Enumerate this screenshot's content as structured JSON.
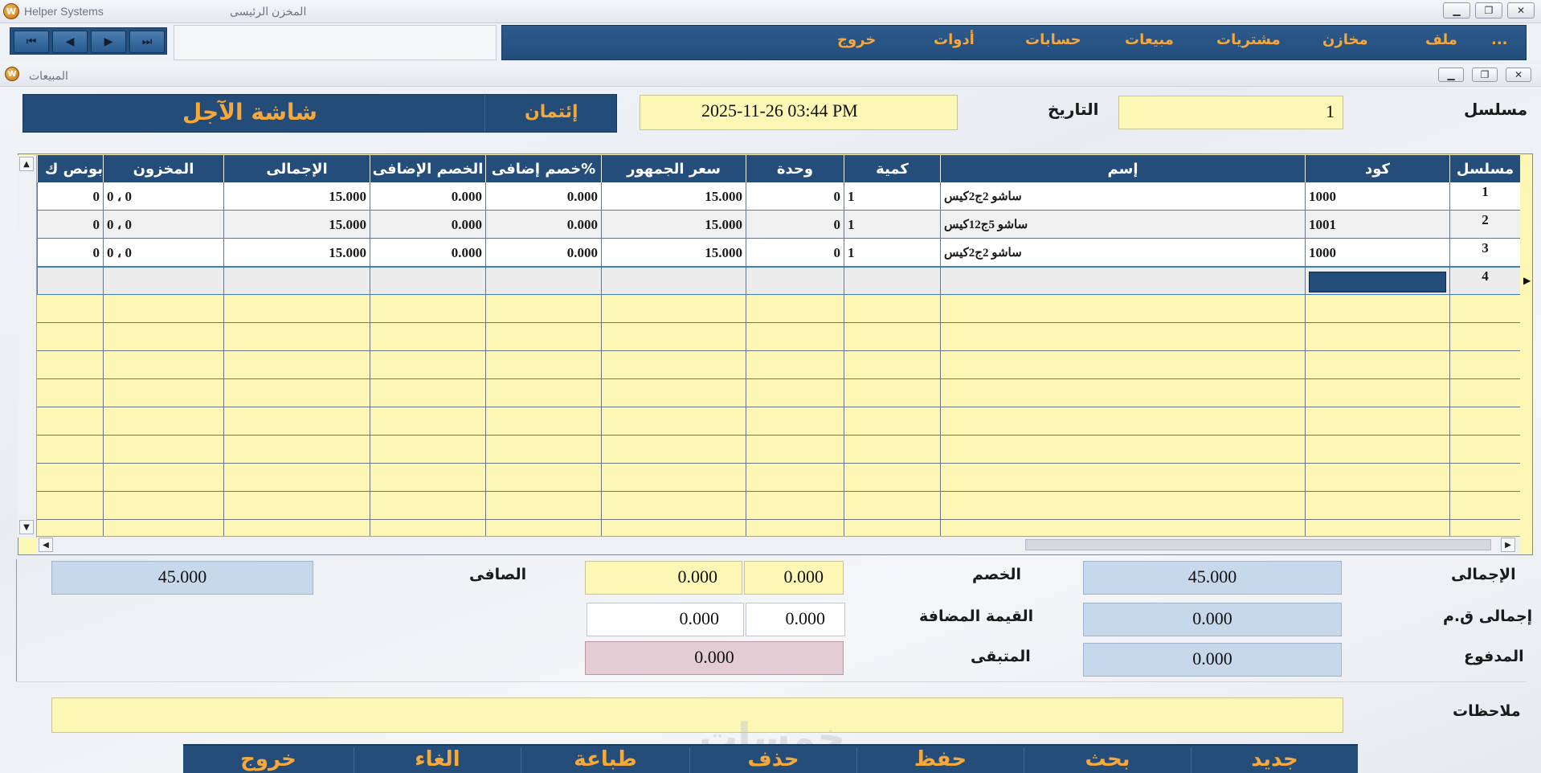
{
  "window": {
    "app_title": "Helper Systems",
    "store_title": "المخزن الرئيسى",
    "controls": [
      "minimize",
      "restore",
      "close"
    ]
  },
  "menu": {
    "items": [
      "...",
      "ملف",
      "مخازن",
      "مشتريات",
      "مبيعات",
      "حسابات",
      "أدوات",
      "خروج"
    ]
  },
  "nav": {
    "first": "⏮",
    "prev": "◀",
    "next": "▶",
    "last": "⏭"
  },
  "child_window": {
    "title": "المبيعات"
  },
  "header": {
    "serial_label": "مسلسل",
    "serial_value": "1",
    "date_label": "التاريخ",
    "date_value": "2025-11-26 03:44 PM",
    "payment_type": "إئتمان",
    "screen_title": "شاشة الآجل"
  },
  "grid": {
    "columns": [
      "مسلسل",
      "كود",
      "إسم",
      "كمية",
      "وحدة",
      "سعر الجمهور",
      "خصم إضافى%",
      "الخصم الإضافى",
      "الإجمالى",
      "المخزون",
      "بونص ك"
    ],
    "rows": [
      {
        "serial": "1",
        "code": "1000",
        "name": "ساشو 2ج2كيس",
        "qty": "1",
        "unit": "0",
        "price": "15.000",
        "disc_pct": "0.000",
        "disc": "0.000",
        "total": "15.000",
        "stock": "0 ، 0",
        "bonus": "0"
      },
      {
        "serial": "2",
        "code": "1001",
        "name": "ساشو 5ج12كيس",
        "qty": "1",
        "unit": "0",
        "price": "15.000",
        "disc_pct": "0.000",
        "disc": "0.000",
        "total": "15.000",
        "stock": "0 ، 0",
        "bonus": "0"
      },
      {
        "serial": "3",
        "code": "1000",
        "name": "ساشو 2ج2كيس",
        "qty": "1",
        "unit": "0",
        "price": "15.000",
        "disc_pct": "0.000",
        "disc": "0.000",
        "total": "15.000",
        "stock": "0 ، 0",
        "bonus": "0"
      },
      {
        "serial": "4",
        "code": "",
        "name": "",
        "qty": "",
        "unit": "",
        "price": "",
        "disc_pct": "",
        "disc": "",
        "total": "",
        "stock": "",
        "bonus": ""
      }
    ]
  },
  "totals": {
    "total_label": "الإجمالى",
    "total_value": "45.000",
    "vat_total_label": "إجمالى ق.م",
    "vat_total_value": "0.000",
    "paid_label": "المدفوع",
    "paid_value": "0.000",
    "discount_label": "الخصم",
    "discount_pct": "0.000",
    "discount_value": "0.000",
    "vat_label": "القيمة المضافة",
    "vat_pct": "0.000",
    "vat_value": "0.000",
    "remaining_label": "المتبقى",
    "remaining_value": "0.000",
    "net_label": "الصافى",
    "net_value": "45.000"
  },
  "notes": {
    "label": "ملاحظات",
    "value": ""
  },
  "actions": [
    "جديد",
    "بحث",
    "حفظ",
    "حذف",
    "طباعة",
    "الغاء",
    "خروج"
  ],
  "watermark": "خمسات"
}
